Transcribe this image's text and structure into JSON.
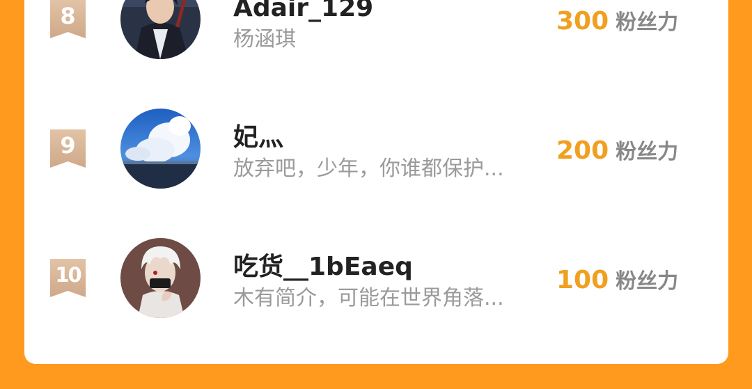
{
  "ranking": {
    "entries": [
      {
        "rank": "8",
        "name": "Adair_129",
        "bio": "杨涵琪",
        "score": "300",
        "unit": "粉丝力"
      },
      {
        "rank": "9",
        "name": "妃灬",
        "bio": "放弃吧，少年，你谁都保护...",
        "score": "200",
        "unit": "粉丝力"
      },
      {
        "rank": "10",
        "name": "吃货__1bEaeq",
        "bio": "木有简介，可能在世界角落...",
        "score": "100",
        "unit": "粉丝力"
      }
    ]
  },
  "colors": {
    "background": "#FF9A1F",
    "card": "#FFFFFF",
    "score": "#F0A020",
    "rank_badge": "#D9B79A",
    "name": "#222222",
    "bio": "#9A9A9A"
  }
}
